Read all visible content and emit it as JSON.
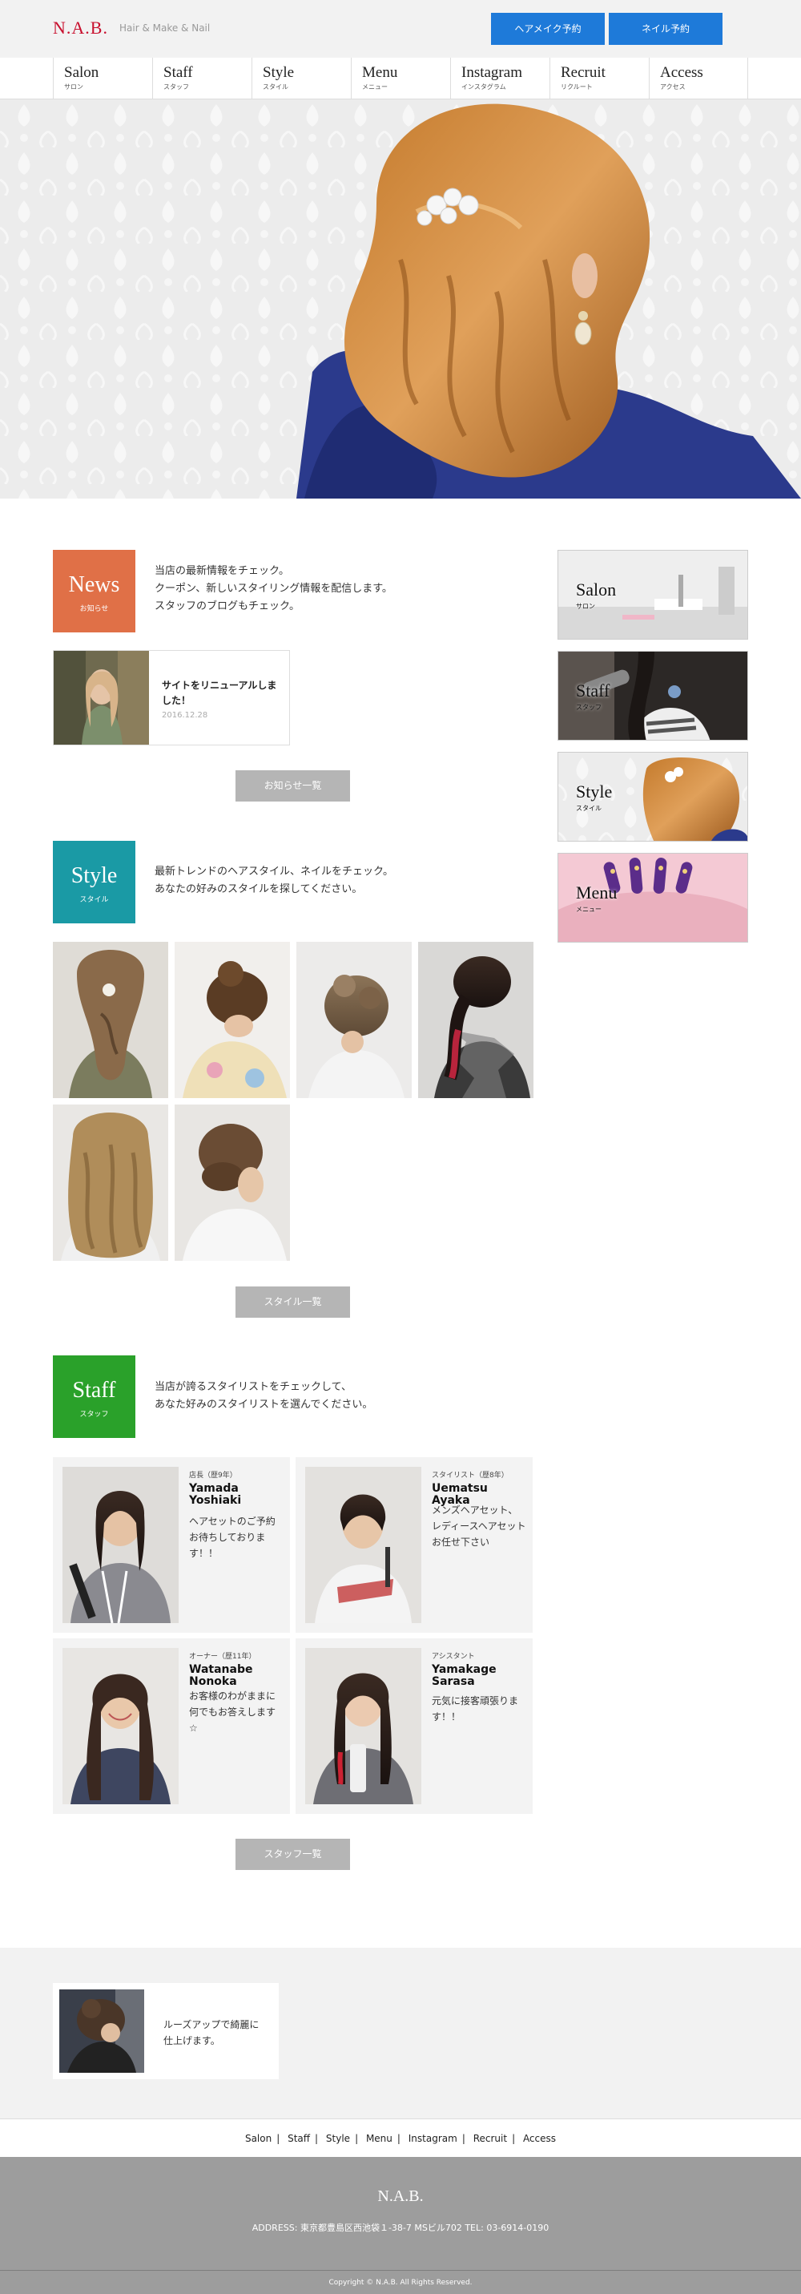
{
  "header": {
    "logo": "N.A.B.",
    "tagline": "Hair & Make & Nail",
    "btn_hair": "ヘアメイク予約",
    "btn_nail": "ネイル予約"
  },
  "nav": [
    {
      "en": "Salon",
      "jp": "サロン"
    },
    {
      "en": "Staff",
      "jp": "スタッフ"
    },
    {
      "en": "Style",
      "jp": "スタイル"
    },
    {
      "en": "Menu",
      "jp": "メニュー"
    },
    {
      "en": "Instagram",
      "jp": "インスタグラム"
    },
    {
      "en": "Recruit",
      "jp": "リクルート"
    },
    {
      "en": "Access",
      "jp": "アクセス"
    }
  ],
  "news": {
    "label_en": "News",
    "label_jp": "お知らせ",
    "desc_1": "当店の最新情報をチェック。",
    "desc_2": "クーポン、新しいスタイリング情報を配信します。",
    "desc_3": "スタッフのブログもチェック。",
    "item_title": "サイトをリニューアルしました！",
    "item_date": "2016.12.28",
    "more": "お知らせ一覧",
    "color": "#e07047"
  },
  "style": {
    "label_en": "Style",
    "label_jp": "スタイル",
    "desc_1": "最新トレンドのヘアスタイル、ネイルをチェック。",
    "desc_2": "あなたの好みのスタイルを探してください。",
    "more": "スタイル一覧",
    "color": "#1a9aa5"
  },
  "staff": {
    "label_en": "Staff",
    "label_jp": "スタッフ",
    "desc_1": "当店が誇るスタイリストをチェックして、",
    "desc_2": "あなた好みのスタイリストを選んでください。",
    "more": "スタッフ一覧",
    "color": "#2aa12a",
    "members": [
      {
        "role": "店長（歴9年）",
        "name": "Yamada Yoshiaki",
        "msg": "ヘアセットのご予約お待ちしております！！"
      },
      {
        "role": "スタイリスト（歴8年）",
        "name": "Uematsu Ayaka",
        "msg": "メンズヘアセット、レディースヘアセットお任せ下さい"
      },
      {
        "role": "オーナー（歴11年）",
        "name": "Watanabe Nonoka",
        "msg": "お客様のわがままに何でもお答えします☆"
      },
      {
        "role": "アシスタント",
        "name": "Yamakage Sarasa",
        "msg": "元気に接客頑張ります！！"
      }
    ]
  },
  "sidebar": [
    {
      "en": "Salon",
      "jp": "サロン"
    },
    {
      "en": "Staff",
      "jp": "スタッフ"
    },
    {
      "en": "Style",
      "jp": "スタイル"
    },
    {
      "en": "Menu",
      "jp": "メニュー"
    }
  ],
  "promo": {
    "text": "ルーズアップで綺麗に仕上げます。"
  },
  "footer_links": [
    "Salon",
    "Staff",
    "Style",
    "Menu",
    "Instagram",
    "Recruit",
    "Access"
  ],
  "footer": {
    "logo": "N.A.B.",
    "address": "ADDRESS: 東京都豊島区西池袋１-38-7 MSビル702 TEL: 03-6914-0190",
    "copyright": "Copyright © N.A.B. All Rights Reserved."
  }
}
